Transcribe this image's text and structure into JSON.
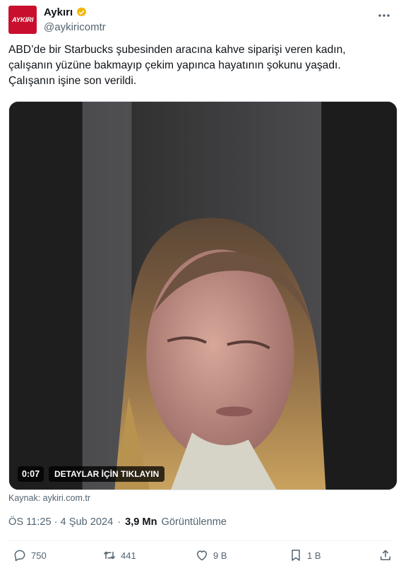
{
  "author": {
    "avatar_text": "AYKIRI",
    "name": "Aykırı",
    "handle": "@aykiricomtr"
  },
  "tweet": {
    "line1": "ABD’de bir Starbucks şubesinden aracına kahve siparişi veren kadın,",
    "line2": "çalışanın yüzüne bakmayıp çekim yapınca hayatının şokunu yaşadı.",
    "line3": "Çalışanın işine son verildi."
  },
  "media": {
    "time": "0:07",
    "cta": "DETAYLAR İÇİN TIKLAYIN"
  },
  "source": "Kaynak: aykiri.com.tr",
  "meta": {
    "timestamp": "ÖS 11:25 · 4 Şub 2024",
    "separator": "·",
    "views": "3,9 Mn",
    "views_label": "Görüntülenme"
  },
  "actions": {
    "replies": "750",
    "reposts": "441",
    "likes": "9 B",
    "bookmarks": "1 B"
  },
  "colors": {
    "accent_verified": "#f4b400",
    "brand_red": "#c8102e",
    "muted": "#536471"
  }
}
